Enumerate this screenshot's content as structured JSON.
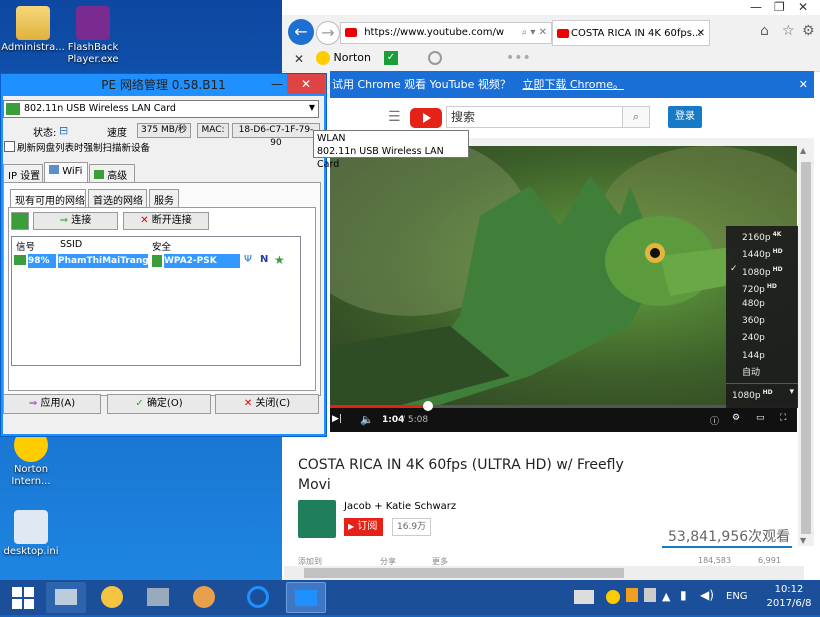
{
  "desktop_icons": [
    {
      "label": "Administra...",
      "icon": "user-folder-icon"
    },
    {
      "label": "FlashBack Player.exe",
      "icon": "flashback-player-icon"
    },
    {
      "label": "Norton Intern...",
      "icon": "norton-icon"
    },
    {
      "label": "desktop.ini",
      "icon": "settings-file-icon"
    }
  ],
  "browser": {
    "url": "https://www.youtube.com/w",
    "tab_title": "COSTA RICA IN 4K 60fps...",
    "toolbar": {
      "norton_label": "Norton"
    },
    "banner": {
      "text": "试用 Chrome 观看 YouTube 视频？",
      "link": "立即下载 Chrome。"
    },
    "yt": {
      "search_placeholder": "搜索",
      "login": "登录"
    },
    "video": {
      "elapsed": "1:04",
      "total": "5:08",
      "progress": 0.21,
      "quality_options": [
        {
          "label": "2160p",
          "badge": "4K"
        },
        {
          "label": "1440p",
          "badge": "HD"
        },
        {
          "label": "1080p",
          "badge": "HD"
        },
        {
          "label": "720p",
          "badge": "HD"
        },
        {
          "label": "480p",
          "badge": ""
        },
        {
          "label": "360p",
          "badge": ""
        },
        {
          "label": "240p",
          "badge": ""
        },
        {
          "label": "144p",
          "badge": ""
        },
        {
          "label": "自动",
          "badge": ""
        }
      ],
      "quality_selected": "1080p",
      "quality_footer": "1080p",
      "quality_footer_badge": "HD"
    },
    "title": "COSTA RICA IN 4K 60fps (ULTRA HD) w/ Freefly Movi",
    "channel": "Jacob + Katie Schwarz",
    "subscribe": "订阅",
    "subscribers": "16.9万",
    "views": "53,841,956次观看",
    "bottom_partial": [
      "添加到",
      "分享",
      "更多",
      "184,583",
      "6,991"
    ]
  },
  "pe_window": {
    "title": "PE 网络管理 0.58.B11",
    "adapter": "802.11n USB Wireless LAN Card",
    "status_label": "状态:",
    "speed_label": "速度",
    "speed_value": "375 MB/秒",
    "mac_label": "MAC:",
    "mac_value": "18-D6-C7-1F-79-90",
    "refresh_checkbox": "刷新网盘列表时强制扫描新设备",
    "tabs": [
      "IP 设置",
      "WiFi",
      "高级"
    ],
    "subtabs": [
      "现有可用的网络",
      "首选的网络",
      "服务"
    ],
    "connect": "连接",
    "disconnect": "断开连接",
    "columns": [
      "信号",
      "SSID",
      "安全"
    ],
    "networks": [
      {
        "signal": "98%",
        "ssid": "PhamThiMaiTrang",
        "security": "WPA2-PSK",
        "mode": "N"
      }
    ],
    "apply": "应用(A)",
    "ok": "确定(O)",
    "close": "关闭(C)"
  },
  "tooltip": {
    "line1": "WLAN",
    "line2": "802.11n USB Wireless LAN Card"
  },
  "taskbar": {
    "language": "ENG",
    "time": "10:12",
    "date": "2017/6/8"
  },
  "colors": {
    "accent_blue": "#1e90ff",
    "youtube_red": "#e62117",
    "chrome_banner": "#1a6fd6",
    "selection": "#3399ff"
  }
}
